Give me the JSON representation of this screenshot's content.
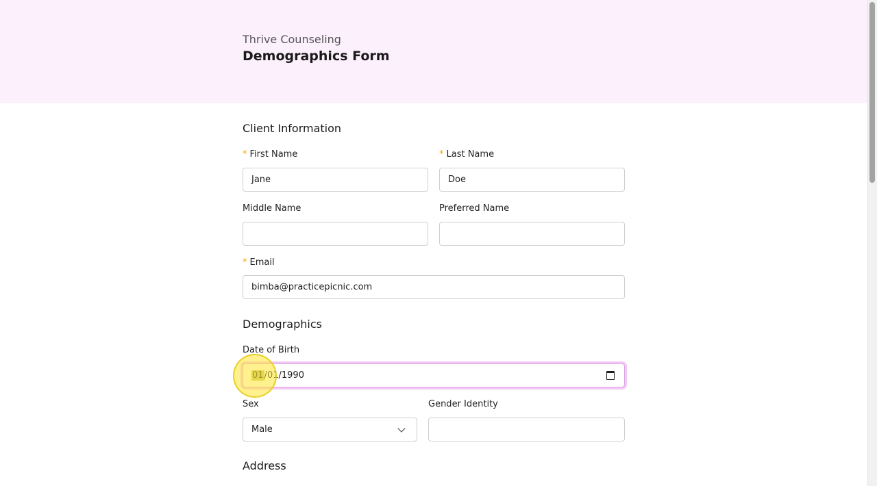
{
  "header": {
    "org_name": "Thrive Counseling",
    "title": "Demographics Form"
  },
  "client_info": {
    "section_title": "Client Information",
    "required_marker": "*",
    "first_name": {
      "label": "First Name",
      "value": "Jane"
    },
    "last_name": {
      "label": "Last Name",
      "value": "Doe"
    },
    "middle_name": {
      "label": "Middle Name",
      "value": ""
    },
    "preferred_name": {
      "label": "Preferred Name",
      "value": ""
    },
    "email": {
      "label": "Email",
      "value": "bimba@practicepicnic.com"
    }
  },
  "demographics": {
    "section_title": "Demographics",
    "dob": {
      "label": "Date of Birth",
      "month": "01",
      "sep1": "/",
      "day": "01",
      "sep2": "/",
      "year": "1990"
    },
    "sex": {
      "label": "Sex",
      "value": "Male"
    },
    "gender_identity": {
      "label": "Gender Identity",
      "value": ""
    }
  },
  "address": {
    "section_title": "Address"
  },
  "colors": {
    "header_bg": "#fcf0fd",
    "required": "#f0a500",
    "focus_ring": "#f3c8f6",
    "cursor_highlight": "#ffe832"
  },
  "icons": [
    "calendar-icon",
    "chevron-down-icon"
  ]
}
